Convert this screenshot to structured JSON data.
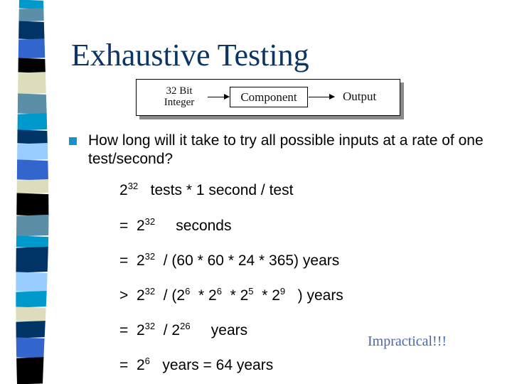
{
  "slide": {
    "title": "Exhaustive Testing",
    "decoration": {
      "name": "striped-left-bar",
      "colors": {
        "cyan": "#0099cc",
        "steel": "#5b8fa8",
        "navy": "#003366",
        "royal": "#3366cc",
        "black": "#000000",
        "cream": "#ddddbb",
        "light": "#99ccff"
      },
      "stripe_sequence": [
        "cyan",
        "steel",
        "navy",
        "royal",
        "black",
        "cream",
        "steel",
        "cyan",
        "navy",
        "light",
        "royal",
        "cream",
        "black",
        "steel",
        "cyan",
        "navy",
        "light",
        "cyan",
        "cream",
        "navy",
        "royal",
        "black"
      ]
    },
    "diagram": {
      "input_line1": "32 Bit",
      "input_line2": "Integer",
      "component": "Component",
      "output": "Output"
    },
    "bullet": {
      "icon": "square-bullet",
      "color": "#1793c9",
      "text": "How long will it take to try all possible inputs at a rate of one test/second?"
    },
    "derivation": [
      {
        "prefix": "",
        "parts": [
          {
            "t": "2",
            "sup": "32"
          },
          {
            "t": "   tests * 1 second / test"
          }
        ]
      },
      {
        "prefix": "=  ",
        "parts": [
          {
            "t": "2",
            "sup": "32"
          },
          {
            "t": "     seconds"
          }
        ]
      },
      {
        "prefix": "=  ",
        "parts": [
          {
            "t": "2",
            "sup": "32"
          },
          {
            "t": "  / (60 * 60 * 24 * 365) years"
          }
        ]
      },
      {
        "prefix": ">  ",
        "parts": [
          {
            "t": "2",
            "sup": "32"
          },
          {
            "t": "  / (2",
            "sup": "6"
          },
          {
            "t": "  * 2",
            "sup": "6"
          },
          {
            "t": "  * 2",
            "sup": "5"
          },
          {
            "t": "  * 2",
            "sup": "9"
          },
          {
            "t": "   ) years"
          }
        ]
      },
      {
        "prefix": "=  ",
        "parts": [
          {
            "t": "2",
            "sup": "32"
          },
          {
            "t": "  / 2",
            "sup": "26"
          },
          {
            "t": "     years"
          }
        ]
      },
      {
        "prefix": "=  ",
        "parts": [
          {
            "t": "2",
            "sup": "6"
          },
          {
            "t": "   years = 64 years"
          }
        ]
      }
    ],
    "callout": "Impractical!!!",
    "colors": {
      "title": "#0d3563",
      "callout": "#4a68a8"
    }
  }
}
